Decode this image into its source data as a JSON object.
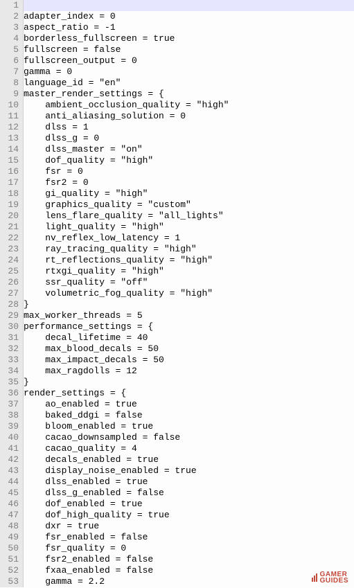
{
  "highlight_lines": [
    1
  ],
  "first_line_number": 1,
  "code_lines": [
    "",
    "adapter_index = 0",
    "aspect_ratio = -1",
    "borderless_fullscreen = true",
    "fullscreen = false",
    "fullscreen_output = 0",
    "gamma = 0",
    "language_id = \"en\"",
    "master_render_settings = {",
    "    ambient_occlusion_quality = \"high\"",
    "    anti_aliasing_solution = 0",
    "    dlss = 1",
    "    dlss_g = 0",
    "    dlss_master = \"on\"",
    "    dof_quality = \"high\"",
    "    fsr = 0",
    "    fsr2 = 0",
    "    gi_quality = \"high\"",
    "    graphics_quality = \"custom\"",
    "    lens_flare_quality = \"all_lights\"",
    "    light_quality = \"high\"",
    "    nv_reflex_low_latency = 1",
    "    ray_tracing_quality = \"high\"",
    "    rt_reflections_quality = \"high\"",
    "    rtxgi_quality = \"high\"",
    "    ssr_quality = \"off\"",
    "    volumetric_fog_quality = \"high\"",
    "}",
    "max_worker_threads = 5",
    "performance_settings = {",
    "    decal_lifetime = 40",
    "    max_blood_decals = 50",
    "    max_impact_decals = 50",
    "    max_ragdolls = 12",
    "}",
    "render_settings = {",
    "    ao_enabled = true",
    "    baked_ddgi = false",
    "    bloom_enabled = true",
    "    cacao_downsampled = false",
    "    cacao_quality = 4",
    "    decals_enabled = true",
    "    display_noise_enabled = true",
    "    dlss_enabled = true",
    "    dlss_g_enabled = false",
    "    dof_enabled = true",
    "    dof_high_quality = true",
    "    dxr = true",
    "    fsr_enabled = false",
    "    fsr_quality = 0",
    "    fsr2_enabled = false",
    "    fxaa_enabled = false",
    "    gamma = 2.2"
  ],
  "watermark": {
    "line1": "GAMER",
    "line2": "GUIDES"
  }
}
